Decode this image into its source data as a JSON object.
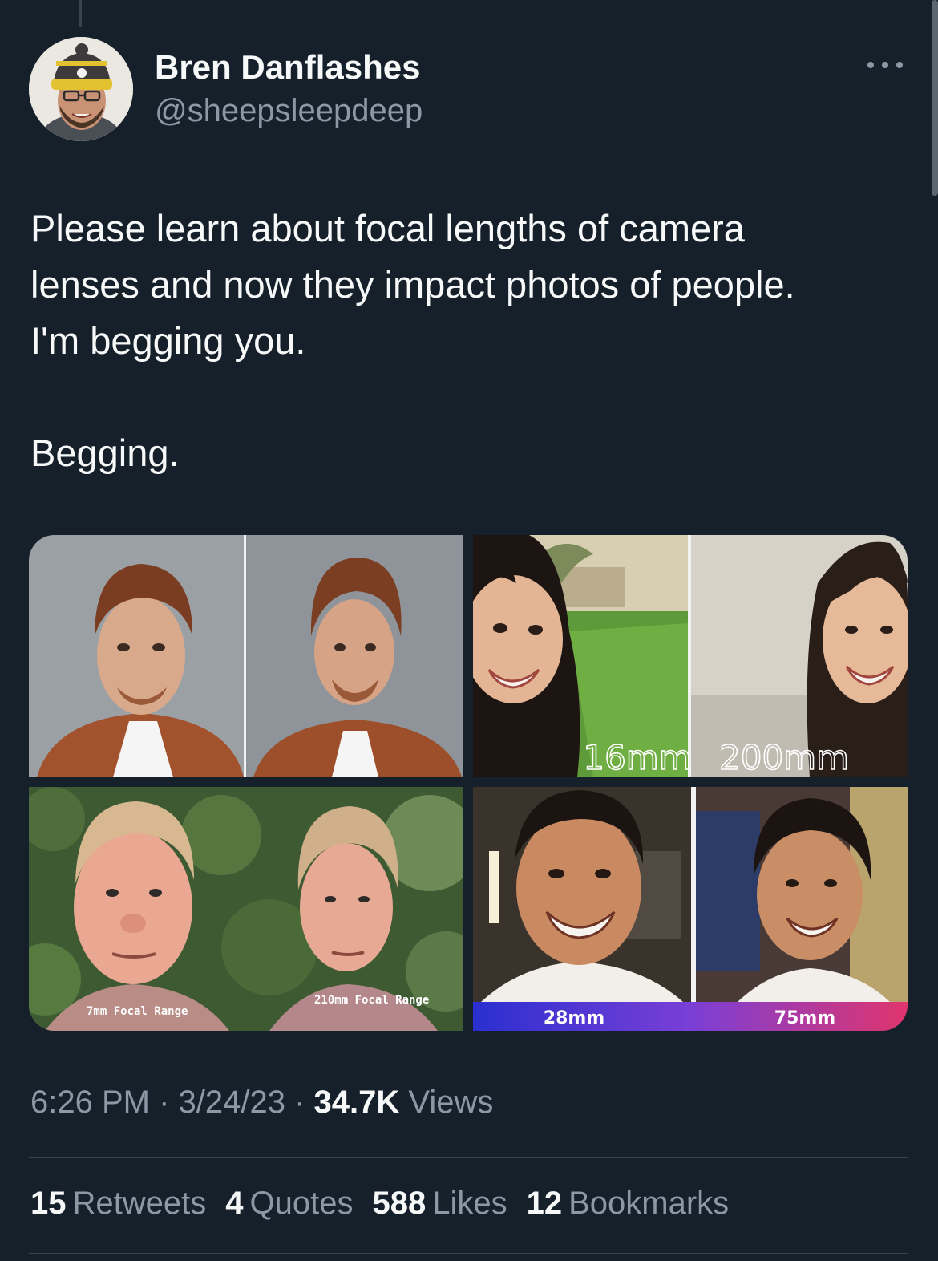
{
  "tweet": {
    "author": {
      "name": "Bren Danflashes",
      "handle": "@sheepsleepdeep"
    },
    "text": {
      "lines": [
        "Please learn about focal lengths of camera",
        "lenses and now they impact photos of people.",
        "I'm begging you."
      ],
      "closing": "Begging."
    },
    "media": {
      "top_right": {
        "left_label": "16mm",
        "right_label": "200mm"
      },
      "bottom_left": {
        "left_label": "7mm Focal Range",
        "right_label": "210mm Focal Range"
      },
      "bottom_right": {
        "left_label": "28mm",
        "right_label": "75mm"
      }
    },
    "meta": {
      "time": "6:26 PM",
      "separator": " · ",
      "date": "3/24/23",
      "views_count": "34.7K",
      "views_label": "Views"
    },
    "stats": {
      "retweets_count": "15",
      "retweets_label": "Retweets",
      "quotes_count": "4",
      "quotes_label": "Quotes",
      "likes_count": "588",
      "likes_label": "Likes",
      "bookmarks_count": "12",
      "bookmarks_label": "Bookmarks"
    }
  },
  "colors": {
    "background": "#15202b",
    "text_primary": "#f7f9f9",
    "text_secondary": "#8b98a5",
    "divider": "#38444d"
  },
  "icons": {
    "more": "more-horizontal-icon"
  }
}
